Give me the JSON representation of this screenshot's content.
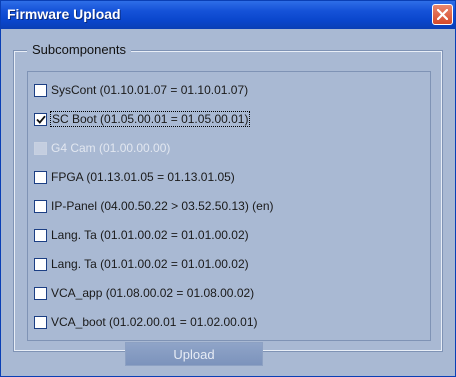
{
  "window": {
    "title": "Firmware Upload"
  },
  "subcomponents": {
    "legend": "Subcomponents",
    "items": [
      {
        "label": "SysCont (01.10.01.07 = 01.10.01.07)",
        "checked": false,
        "enabled": true,
        "focused": false
      },
      {
        "label": "SC Boot (01.05.00.01 = 01.05.00.01)",
        "checked": true,
        "enabled": true,
        "focused": true
      },
      {
        "label": "G4 Cam (01.00.00.00)",
        "checked": false,
        "enabled": false,
        "focused": false
      },
      {
        "label": "FPGA (01.13.01.05 = 01.13.01.05)",
        "checked": false,
        "enabled": true,
        "focused": false
      },
      {
        "label": "IP-Panel (04.00.50.22 > 03.52.50.13) (en)",
        "checked": false,
        "enabled": true,
        "focused": false
      },
      {
        "label": "Lang. Ta (01.01.00.02 = 01.01.00.02)",
        "checked": false,
        "enabled": true,
        "focused": false
      },
      {
        "label": "Lang. Ta (01.01.00.02 = 01.01.00.02)",
        "checked": false,
        "enabled": true,
        "focused": false
      },
      {
        "label": "VCA_app (01.08.00.02 = 01.08.00.02)",
        "checked": false,
        "enabled": true,
        "focused": false
      },
      {
        "label": "VCA_boot (01.02.00.01 = 01.02.00.01)",
        "checked": false,
        "enabled": true,
        "focused": false
      }
    ]
  },
  "actions": {
    "upload_label": "Upload"
  },
  "icons": {
    "close": "close-icon",
    "check": "checkmark-icon"
  }
}
